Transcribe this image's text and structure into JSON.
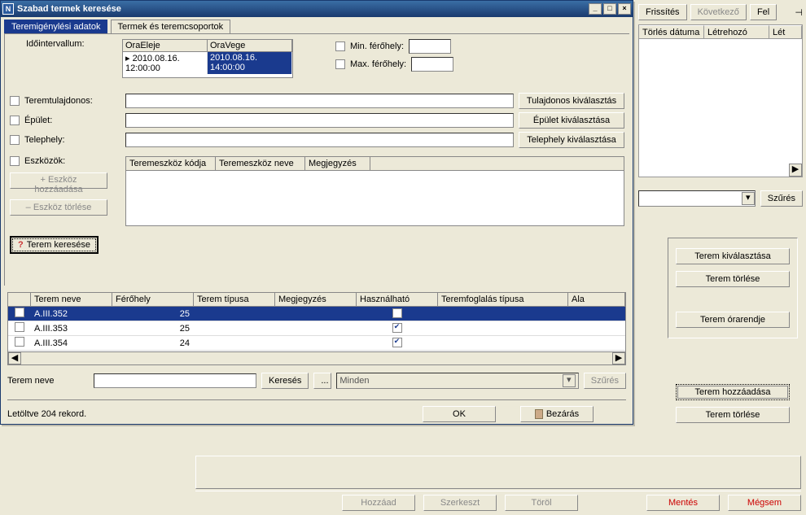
{
  "right_top": {
    "refresh": "Frissítés",
    "next": "Következő",
    "up": "Fel"
  },
  "right_headers": {
    "del_date": "Törlés dátuma",
    "creator": "Létrehozó",
    "let": "Lét"
  },
  "szures_btn": "Szűrés",
  "right_group1": {
    "select_room": "Terem kiválasztása",
    "delete_room": "Terem törlése",
    "schedule": "Terem órarendje"
  },
  "right_group2": {
    "add_room": "Terem hozzáadása",
    "delete_room": "Terem törlése"
  },
  "bottom": {
    "add": "Hozzáad",
    "edit": "Szerkeszt",
    "delete": "Töröl",
    "save": "Mentés",
    "cancel": "Mégsem"
  },
  "dialog": {
    "title": "Szabad termek keresése",
    "tabs": {
      "active": "Teremigénylési adatok",
      "other": "Termek és teremcsoportok"
    },
    "labels": {
      "interval": "Időintervallum:",
      "min_cap": "Min. férőhely:",
      "max_cap": "Max. férőhely:",
      "owner": "Teremtulajdonos:",
      "building": "Épület:",
      "site": "Telephely:",
      "tools": "Eszközök:"
    },
    "timegrid": {
      "h1": "OraEleje",
      "h2": "OraVege",
      "v1": "2010.08.16. 12:00:00",
      "v2": "2010.08.16. 14:00:00"
    },
    "buttons": {
      "owner_select": "Tulajdonos kiválasztás",
      "building_select": "Épület kiválasztása",
      "site_select": "Telephely kiválasztása",
      "add_tool": "Eszköz hozzáadása",
      "del_tool": "Eszköz törlése",
      "search_room": "Terem keresése"
    },
    "tool_headers": {
      "code": "Teremeszköz kódja",
      "name": "Teremeszköz neve",
      "note": "Megjegyzés"
    },
    "results": {
      "headers": {
        "name": "Terem neve",
        "cap": "Férőhely",
        "type": "Terem típusa",
        "note": "Megjegyzés",
        "usable": "Használható",
        "restype": "Teremfoglalás típusa",
        "ala": "Ala"
      },
      "rows": [
        {
          "name": "A.III.352",
          "cap": "25",
          "usable": true
        },
        {
          "name": "A.III.353",
          "cap": "25",
          "usable": true
        },
        {
          "name": "A.III.354",
          "cap": "24",
          "usable": true
        }
      ]
    },
    "bottom_search": {
      "label": "Terem neve",
      "search": "Keresés",
      "all": "Minden",
      "filter": "Szűrés"
    },
    "status": "Letöltve 204 rekord.",
    "ok": "OK",
    "close": "Bezárás"
  }
}
